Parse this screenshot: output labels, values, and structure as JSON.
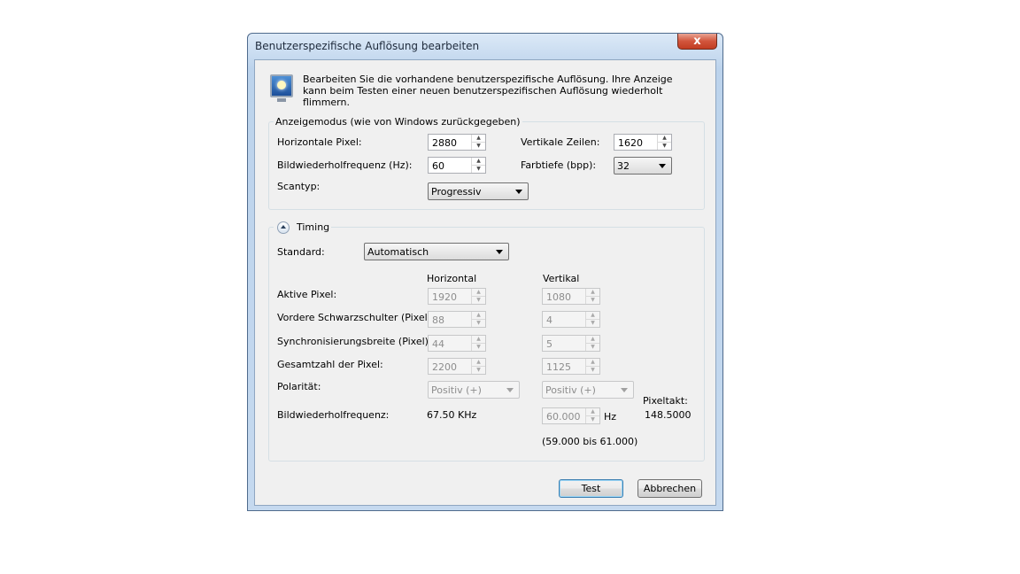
{
  "window": {
    "title": "Benutzerspezifische Auflösung bearbeiten",
    "close_label": "x"
  },
  "intro": {
    "icon": "monitor-icon",
    "text": "Bearbeiten Sie die vorhandene benutzerspezifische Auflösung. Ihre Anzeige kann beim Testen einer neuen benutzerspezifischen Auflösung wiederholt flimmern."
  },
  "display_mode": {
    "legend": "Anzeigemodus (wie von Windows zurückgegeben)",
    "horizontal_pixels": {
      "label": "Horizontale Pixel:",
      "value": "2880"
    },
    "vertical_lines": {
      "label": "Vertikale Zeilen:",
      "value": "1620"
    },
    "refresh_rate": {
      "label": "Bildwiederholfrequenz (Hz):",
      "value": "60"
    },
    "color_depth": {
      "label": "Farbtiefe (bpp):",
      "value": "32"
    },
    "scan_type": {
      "label": "Scantyp:",
      "value": "Progressiv"
    }
  },
  "timing": {
    "legend": "Timing",
    "standard": {
      "label": "Standard:",
      "value": "Automatisch"
    },
    "col_horizontal": "Horizontal",
    "col_vertical": "Vertikal",
    "rows": [
      {
        "label": "Aktive Pixel:",
        "h": "1920",
        "v": "1080"
      },
      {
        "label": "Vordere Schwarzschulter (Pixel):",
        "h": "88",
        "v": "4"
      },
      {
        "label": "Synchronisierungsbreite (Pixel):",
        "h": "44",
        "v": "5"
      },
      {
        "label": "Gesamtzahl der Pixel:",
        "h": "2200",
        "v": "1125"
      }
    ],
    "polarity": {
      "label": "Polarität:",
      "h": "Positiv (+)",
      "v": "Positiv (+)"
    },
    "refresh": {
      "label": "Bildwiederholfrequenz:",
      "h_value": "67.50 KHz",
      "v_value": "60.000",
      "v_unit": "Hz",
      "range": "(59.000 bis 61.000)"
    },
    "pixel_clock": {
      "label": "Pixeltakt:",
      "value": "148.5000"
    }
  },
  "buttons": {
    "test": "Test",
    "cancel": "Abbrechen"
  }
}
